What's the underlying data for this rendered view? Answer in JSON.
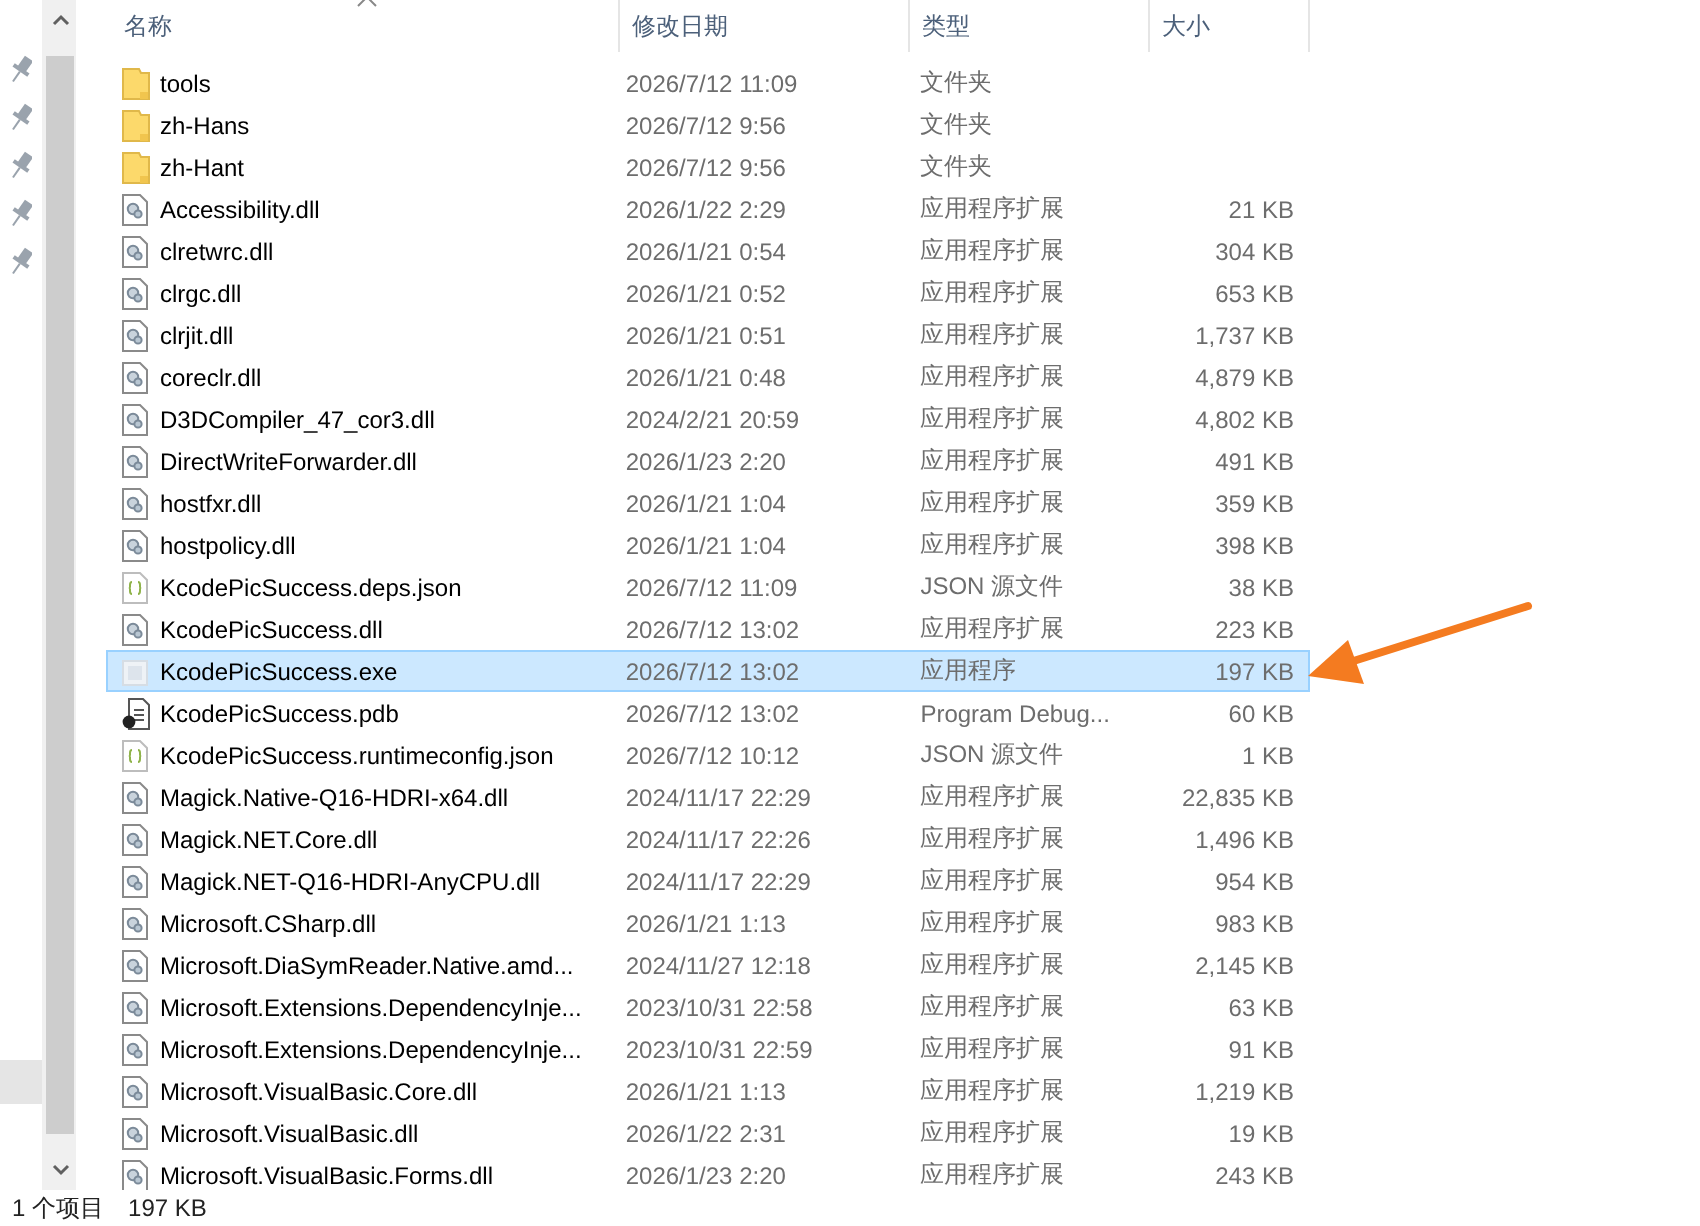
{
  "columns": [
    {
      "label": "名称",
      "sorted": true
    },
    {
      "label": "修改日期",
      "sorted": false
    },
    {
      "label": "类型",
      "sorted": false
    },
    {
      "label": "大小",
      "sorted": false
    }
  ],
  "nav": {
    "pins": [
      {
        "pinned": true
      },
      {
        "pinned": true
      },
      {
        "pinned": true
      },
      {
        "pinned": true
      },
      {
        "pinned": true
      }
    ]
  },
  "rows": [
    {
      "kind": "folder",
      "name": "tools",
      "modified": "2026/7/12 11:09",
      "type": "文件夹",
      "selected": false
    },
    {
      "kind": "folder",
      "name": "zh-Hans",
      "modified": "2026/7/12 9:56",
      "type": "文件夹",
      "selected": false
    },
    {
      "kind": "folder",
      "name": "zh-Hant",
      "modified": "2026/7/12 9:56",
      "type": "文件夹",
      "selected": false
    },
    {
      "kind": "dll",
      "name": "Accessibility.dll",
      "modified": "2026/1/22 2:29",
      "type": "应用程序扩展",
      "size": "21 KB",
      "selected": false
    },
    {
      "kind": "dll",
      "name": "clretwrc.dll",
      "modified": "2026/1/21 0:54",
      "type": "应用程序扩展",
      "size": "304 KB",
      "selected": false
    },
    {
      "kind": "dll",
      "name": "clrgc.dll",
      "modified": "2026/1/21 0:52",
      "type": "应用程序扩展",
      "size": "653 KB",
      "selected": false
    },
    {
      "kind": "dll",
      "name": "clrjit.dll",
      "modified": "2026/1/21 0:51",
      "type": "应用程序扩展",
      "size": "1,737 KB",
      "selected": false
    },
    {
      "kind": "dll",
      "name": "coreclr.dll",
      "modified": "2026/1/21 0:48",
      "type": "应用程序扩展",
      "size": "4,879 KB",
      "selected": false
    },
    {
      "kind": "dll",
      "name": "D3DCompiler_47_cor3.dll",
      "modified": "2024/2/21 20:59",
      "type": "应用程序扩展",
      "size": "4,802 KB",
      "selected": false
    },
    {
      "kind": "dll",
      "name": "DirectWriteForwarder.dll",
      "modified": "2026/1/23 2:20",
      "type": "应用程序扩展",
      "size": "491 KB",
      "selected": false
    },
    {
      "kind": "dll",
      "name": "hostfxr.dll",
      "modified": "2026/1/21 1:04",
      "type": "应用程序扩展",
      "size": "359 KB",
      "selected": false
    },
    {
      "kind": "dll",
      "name": "hostpolicy.dll",
      "modified": "2026/1/21 1:04",
      "type": "应用程序扩展",
      "size": "398 KB",
      "selected": false
    },
    {
      "kind": "json",
      "name": "KcodePicSuccess.deps.json",
      "modified": "2026/7/12 11:09",
      "type": "JSON 源文件",
      "size": "38 KB",
      "selected": false
    },
    {
      "kind": "dll",
      "name": "KcodePicSuccess.dll",
      "modified": "2026/7/12 13:02",
      "type": "应用程序扩展",
      "size": "223 KB",
      "selected": false
    },
    {
      "kind": "exe",
      "name": "KcodePicSuccess.exe",
      "modified": "2026/7/12 13:02",
      "type": "应用程序",
      "size": "197 KB",
      "selected": true
    },
    {
      "kind": "pdb",
      "name": "KcodePicSuccess.pdb",
      "modified": "2026/7/12 13:02",
      "type": "Program Debug...",
      "size": "60 KB",
      "selected": false
    },
    {
      "kind": "json",
      "name": "KcodePicSuccess.runtimeconfig.json",
      "modified": "2026/7/12 10:12",
      "type": "JSON 源文件",
      "size": "1 KB",
      "selected": false
    },
    {
      "kind": "dll",
      "name": "Magick.Native-Q16-HDRI-x64.dll",
      "modified": "2024/11/17 22:29",
      "type": "应用程序扩展",
      "size": "22,835 KB",
      "selected": false
    },
    {
      "kind": "dll",
      "name": "Magick.NET.Core.dll",
      "modified": "2024/11/17 22:26",
      "type": "应用程序扩展",
      "size": "1,496 KB",
      "selected": false
    },
    {
      "kind": "dll",
      "name": "Magick.NET-Q16-HDRI-AnyCPU.dll",
      "modified": "2024/11/17 22:29",
      "type": "应用程序扩展",
      "size": "954 KB",
      "selected": false
    },
    {
      "kind": "dll",
      "name": "Microsoft.CSharp.dll",
      "modified": "2026/1/21 1:13",
      "type": "应用程序扩展",
      "size": "983 KB",
      "selected": false
    },
    {
      "kind": "dll",
      "name": "Microsoft.DiaSymReader.Native.amd...",
      "modified": "2024/11/27 12:18",
      "type": "应用程序扩展",
      "size": "2,145 KB",
      "selected": false
    },
    {
      "kind": "dll",
      "name": "Microsoft.Extensions.DependencyInje...",
      "modified": "2023/10/31 22:58",
      "type": "应用程序扩展",
      "size": "63 KB",
      "selected": false
    },
    {
      "kind": "dll",
      "name": "Microsoft.Extensions.DependencyInje...",
      "modified": "2023/10/31 22:59",
      "type": "应用程序扩展",
      "size": "91 KB",
      "selected": false
    },
    {
      "kind": "dll",
      "name": "Microsoft.VisualBasic.Core.dll",
      "modified": "2026/1/21 1:13",
      "type": "应用程序扩展",
      "size": "1,219 KB",
      "selected": false
    },
    {
      "kind": "dll",
      "name": "Microsoft.VisualBasic.dll",
      "modified": "2026/1/22 2:31",
      "type": "应用程序扩展",
      "size": "19 KB",
      "selected": false
    },
    {
      "kind": "dll",
      "name": "Microsoft.VisualBasic.Forms.dll",
      "modified": "2026/1/23 2:20",
      "type": "应用程序扩展",
      "size": "243 KB",
      "selected": false
    }
  ],
  "status_bar": {
    "count": "1 个项目",
    "size": "197 KB"
  }
}
